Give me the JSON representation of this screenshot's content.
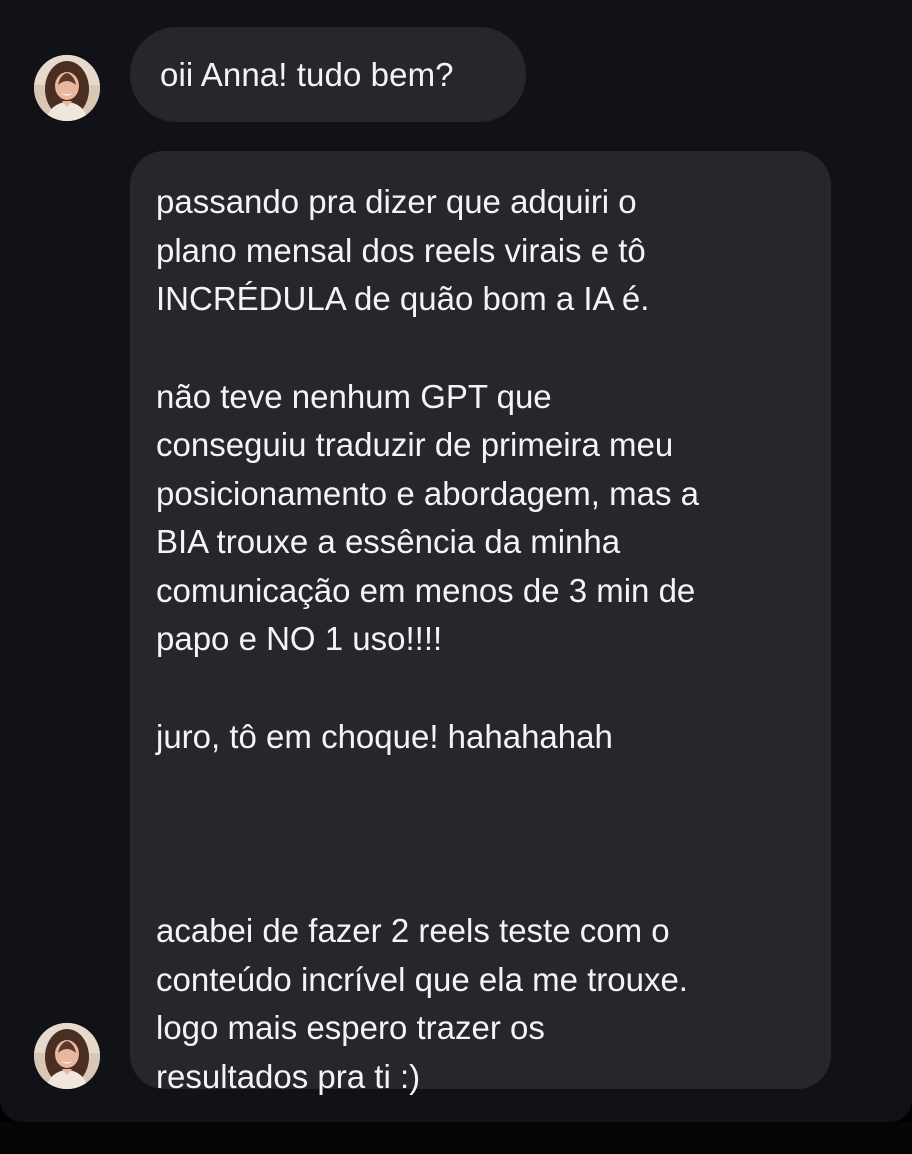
{
  "conversation": {
    "messages": [
      {
        "text": "oii Anna! tudo bem?"
      },
      {
        "paragraphs": [
          {
            "lines": [
              "passando pra dizer que adquiri o",
              "plano mensal dos reels virais e tô",
              "INCRÉDULA de quão bom a IA é."
            ]
          },
          {
            "lines": [
              "não teve nenhum GPT que",
              "conseguiu traduzir de primeira meu",
              "posicionamento e abordagem, mas a",
              "BIA trouxe a essência da minha",
              "comunicação em menos de 3 min de",
              "papo e NO 1 uso!!!!"
            ]
          },
          {
            "lines": [
              "juro, tô em choque! hahahahah"
            ]
          },
          {
            "lines": [
              "acabei de fazer 2 reels teste com o",
              "conteúdo incrível que ela me trouxe.",
              "logo mais espero trazer os",
              "resultados pra ti :)"
            ]
          }
        ]
      }
    ]
  },
  "colors": {
    "panel_background": "#111217",
    "bubble_background": "#26272c",
    "text": "#f4f4f4"
  }
}
